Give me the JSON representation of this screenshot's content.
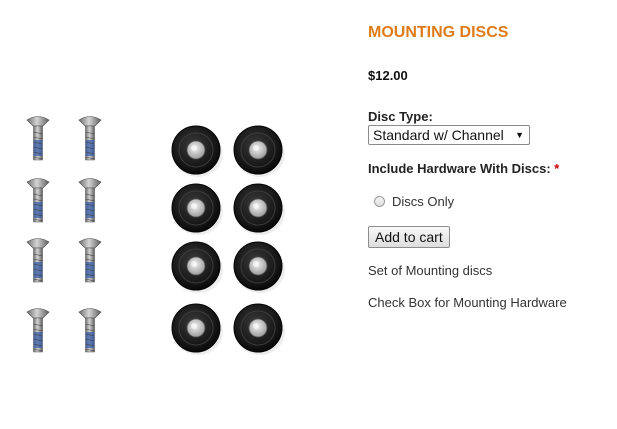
{
  "colors": {
    "title": "#e07b1a",
    "required": "#cc0000",
    "bolt": "#9a9a9a",
    "bolt_blue": "#3a5fa8",
    "disc": "#1b1b1b"
  },
  "image": {
    "alt_icon": "mounting-hardware-photo",
    "screw_rows": 4,
    "disc_rows": 4
  },
  "product": {
    "title": "MOUNTING DISCS",
    "price": "$12.00"
  },
  "options": {
    "disc_type_label": "Disc Type:",
    "disc_type_selected": "Standard w/ Channel",
    "hardware_label": "Include Hardware With Discs:",
    "required_mark": "*",
    "radio_option": "Discs Only"
  },
  "actions": {
    "add_to_cart": "Add to cart"
  },
  "description": {
    "line1": "Set of Mounting discs",
    "line2": "Check Box for Mounting Hardware"
  }
}
